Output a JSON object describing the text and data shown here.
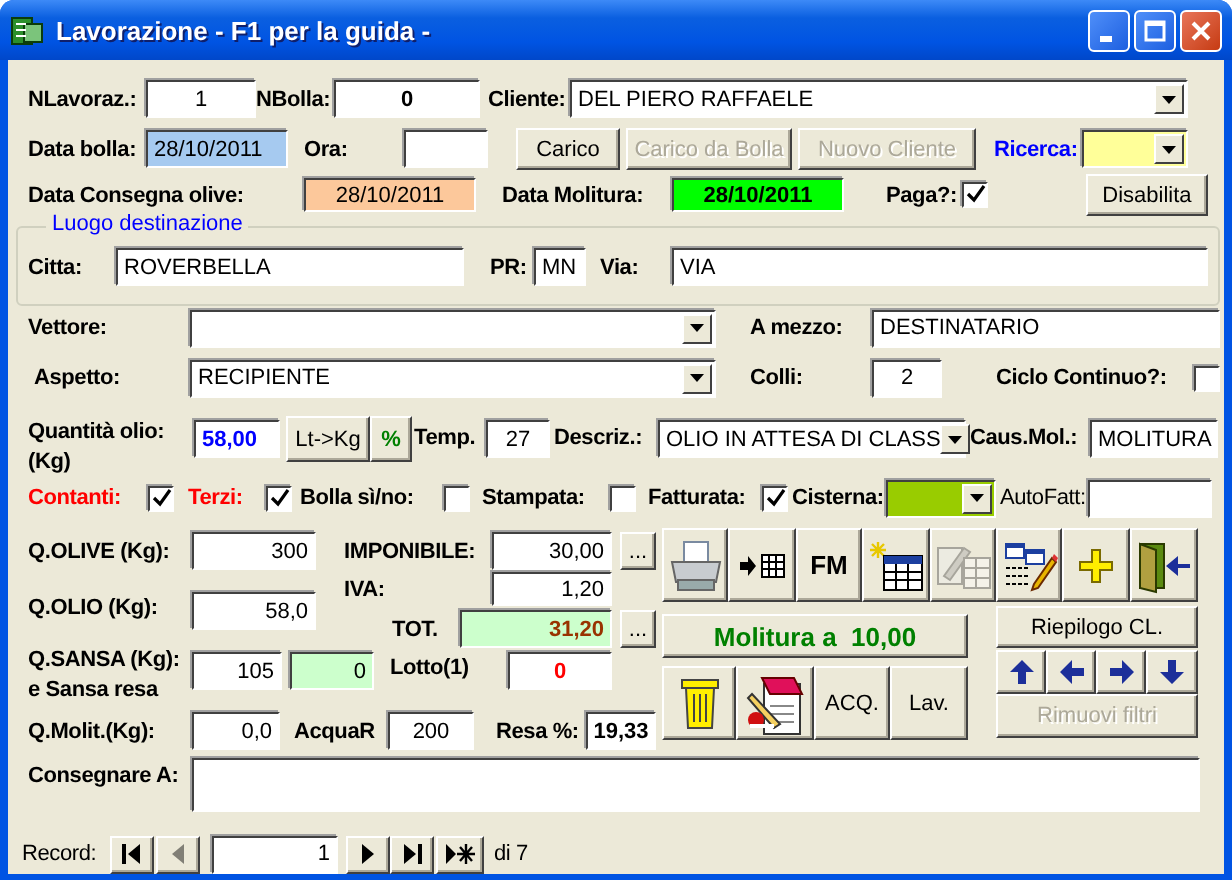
{
  "window": {
    "title": "Lavorazione - F1 per la guida -"
  },
  "header": {
    "nlavoraz": {
      "label": "NLavoraz.:",
      "value": "1"
    },
    "nbolla": {
      "label": "NBolla:",
      "value": "0"
    },
    "cliente": {
      "label": "Cliente:",
      "value": "DEL PIERO RAFFAELE"
    },
    "data_bolla": {
      "label": "Data bolla:",
      "value": "28/10/2011"
    },
    "ora": {
      "label": "Ora:"
    },
    "buttons": [
      {
        "label": "Carico",
        "disabled": false
      },
      {
        "label": "Carico da Bolla",
        "disabled": true
      },
      {
        "label": "Nuovo Cliente",
        "disabled": true
      }
    ],
    "ricerca": {
      "label": "Ricerca:"
    },
    "data_consegna": {
      "label": "Data Consegna olive:",
      "value": "28/10/2011"
    },
    "data_molitura": {
      "label": "Data Molitura:",
      "value": "28/10/2011"
    },
    "paga": {
      "label": "Paga?:",
      "checked": true
    },
    "disabilita": {
      "label": "Disabilita"
    }
  },
  "luogo": {
    "title": "Luogo destinazione",
    "citta": {
      "label": "Citta:",
      "value": "ROVERBELLA"
    },
    "pr": {
      "label": "PR:",
      "value": "MN"
    },
    "via": {
      "label": "Via:",
      "value": "VIA"
    }
  },
  "trasporto": {
    "vettore": {
      "label": "Vettore:"
    },
    "a_mezzo": {
      "label": "A mezzo:",
      "value": "DESTINATARIO"
    },
    "aspetto": {
      "label": "Aspetto:",
      "value": "RECIPIENTE"
    },
    "colli": {
      "label": "Colli:",
      "value": "2"
    },
    "ciclo_continuo": {
      "label": "Ciclo Continuo?:",
      "checked": false
    }
  },
  "olio": {
    "quantita": {
      "label": "Quantità olio:",
      "unit": "(Kg)",
      "value": "58,00"
    },
    "lt_kg": {
      "label": "Lt->Kg"
    },
    "percent": {
      "label": "%"
    },
    "temp": {
      "label": "Temp.",
      "value": "27"
    },
    "descriz": {
      "label": "Descriz.:",
      "value": "OLIO IN ATTESA DI CLASS"
    },
    "caus_mol": {
      "label": "Caus.Mol.:",
      "value": "MOLITURA"
    }
  },
  "flags": [
    {
      "label": "Contanti:",
      "checked": true,
      "color": "#ff0000"
    },
    {
      "label": "Terzi:",
      "checked": true,
      "color": "#ff0000"
    },
    {
      "label": "Bolla sì/no:",
      "checked": false,
      "color": "#000000"
    },
    {
      "label": "Stampata:",
      "checked": false,
      "color": "#000000"
    },
    {
      "label": "Fatturata:",
      "checked": true,
      "color": "#000000"
    }
  ],
  "cisterna": {
    "label": "Cisterna:"
  },
  "autofatt": {
    "label": "AutoFatt:"
  },
  "importi": {
    "q_olive": {
      "label": "Q.OLIVE (Kg):",
      "value": "300"
    },
    "imponibile": {
      "label": "IMPONIBILE:",
      "value": "30,00",
      "button": "..."
    },
    "iva": {
      "label": "IVA:",
      "value": "1,20"
    },
    "q_olio": {
      "label": "Q.OLIO (Kg):",
      "value": "58,0"
    },
    "tot": {
      "label": "TOT.",
      "value": "31,20",
      "button": "..."
    },
    "q_sansa": {
      "label": "Q.SANSA (Kg):",
      "sublabel": "e Sansa resa",
      "value": "105",
      "resa_value": "0"
    },
    "lotto": {
      "label": "Lotto(1)",
      "value": "0"
    },
    "q_molit": {
      "label": "Q.Molit.(Kg):",
      "value": "0,0"
    },
    "acquar": {
      "label": "AcquaR",
      "value": "200"
    },
    "resa": {
      "label": "Resa %:",
      "value": "19,33"
    }
  },
  "toolbar": [
    {
      "disabled": false
    },
    {
      "disabled": false
    },
    {
      "label": "FM",
      "disabled": false
    },
    {
      "disabled": false
    },
    {
      "disabled": true
    },
    {
      "disabled": false
    },
    {
      "disabled": false
    },
    {
      "disabled": false
    }
  ],
  "molitura": {
    "label": "Molitura a  10,00"
  },
  "actions": [
    {
      "disabled": false
    },
    {
      "disabled": false
    },
    {
      "label": "ACQ.",
      "disabled": false
    },
    {
      "label": "Lav.",
      "disabled": false
    }
  ],
  "riepilogo": {
    "label": "Riepilogo CL."
  },
  "rimuovi_filtri": {
    "label": "Rimuovi filtri",
    "disabled": true
  },
  "consegnare": {
    "label": "Consegnare A:"
  },
  "record_nav": {
    "label": "Record:",
    "value": "1",
    "count": "di 7",
    "buttons": [
      {
        "disabled": false
      },
      {
        "disabled": true
      },
      {
        "disabled": false
      },
      {
        "disabled": false
      },
      {
        "disabled": false
      }
    ]
  }
}
